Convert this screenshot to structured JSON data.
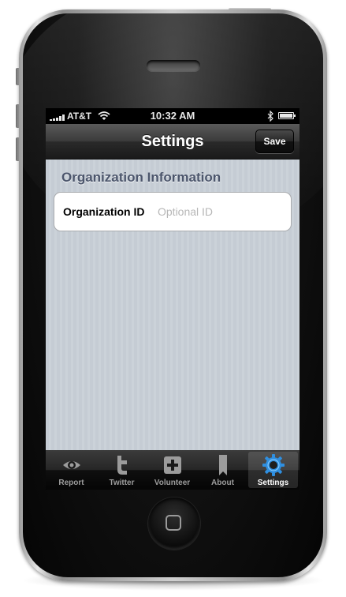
{
  "status_bar": {
    "carrier": "AT&T",
    "time": "10:32 AM",
    "signal_bars": 5,
    "wifi_icon": "wifi-icon",
    "bluetooth_icon": "bluetooth-icon",
    "battery_icon": "battery-icon"
  },
  "nav_bar": {
    "title": "Settings",
    "save_label": "Save"
  },
  "section": {
    "header": "Organization Information"
  },
  "org_id_field": {
    "label": "Organization ID",
    "value": "",
    "placeholder": "Optional ID"
  },
  "tab_bar": {
    "tabs": [
      {
        "label": "Report",
        "icon": "eye-icon",
        "active": false
      },
      {
        "label": "Twitter",
        "icon": "twitter-bird-icon",
        "active": false
      },
      {
        "label": "Volunteer",
        "icon": "plus-icon",
        "active": false
      },
      {
        "label": "About",
        "icon": "bookmark-icon",
        "active": false
      },
      {
        "label": "Settings",
        "icon": "gear-icon",
        "active": true
      }
    ]
  },
  "colors": {
    "content_background": "#c5ccd4",
    "section_header": "#4c566c",
    "active_tab_icon": "#2f8fe0",
    "inactive_tab_icon": "#9c9c9c"
  }
}
